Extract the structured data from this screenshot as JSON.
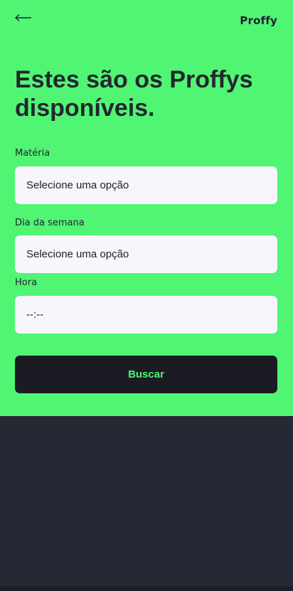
{
  "header": {
    "back_icon": "arrow-left-icon",
    "logo": "Proffy",
    "title_line1": "Estes são os Proffys",
    "title_line2": "disponíveis."
  },
  "form": {
    "subject": {
      "label": "Matéria",
      "value": "Selecione uma opção"
    },
    "weekday": {
      "label": "Dia da semana",
      "value": "Selecione uma opção"
    },
    "time": {
      "label": "Hora",
      "value": "--:--"
    },
    "submit_label": "Buscar"
  },
  "colors": {
    "header_bg": "#50f574",
    "page_bg": "#262833",
    "input_bg": "#f7f6fc",
    "button_bg": "#1b1b24",
    "button_text": "#50f574",
    "title_text": "#23262f"
  }
}
